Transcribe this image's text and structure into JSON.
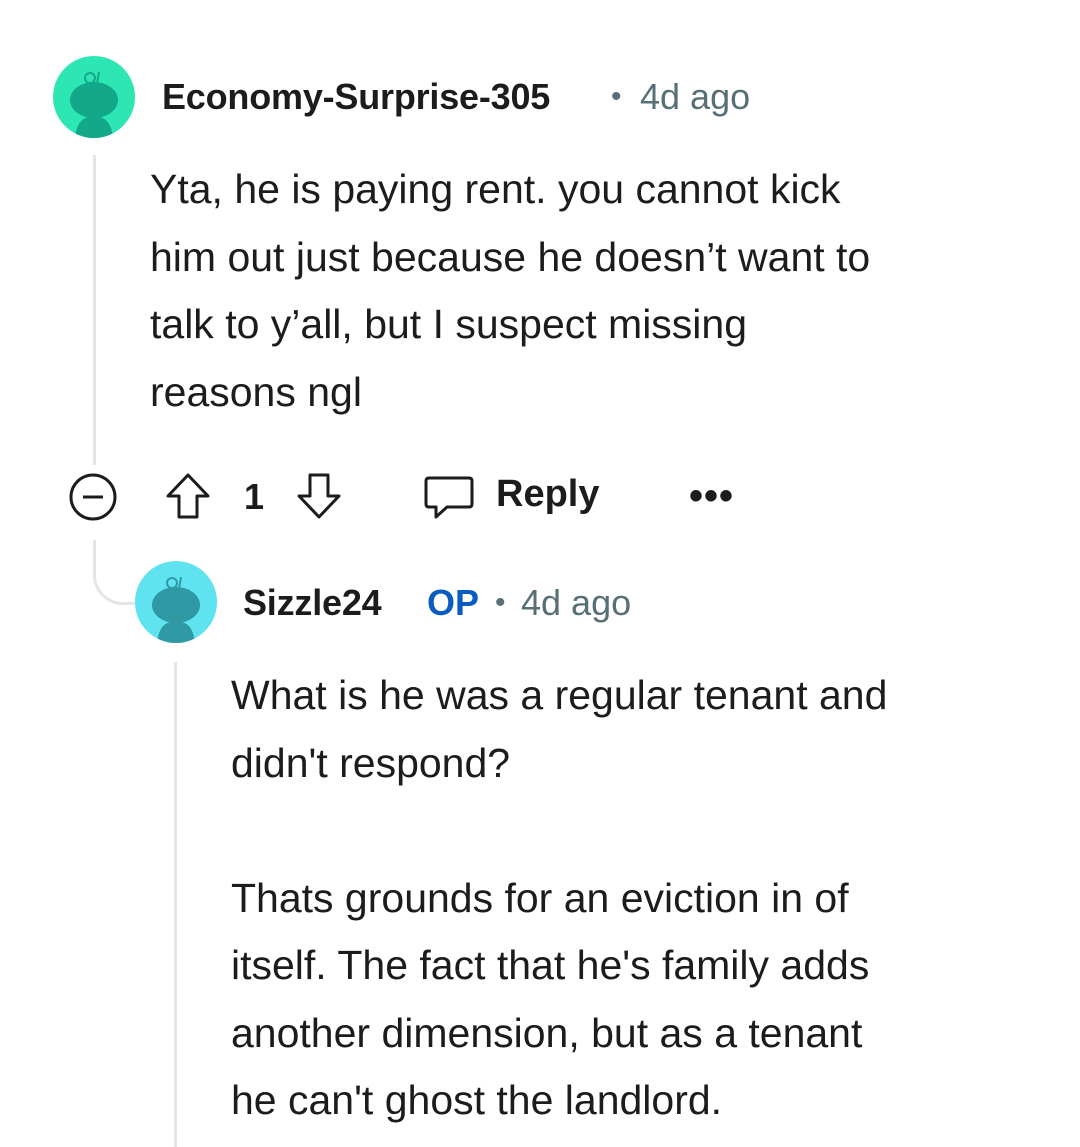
{
  "colors": {
    "avatar1_bg": "#2ee6b4",
    "avatar1_figure": "#14a88a",
    "avatar2_bg": "#5fe3f0",
    "avatar2_figure": "#2f9aa6",
    "op_badge": "#0a5cc2",
    "meta": "#576f76",
    "thread_line": "#e3e6e8"
  },
  "comment": {
    "username": "Economy-Surprise-305",
    "separator": "•",
    "age": "4d ago",
    "text": "Yta, he is paying rent. you cannot kick\nhim out just because he doesn’t want to\ntalk to y’all, but I suspect missing\nreasons ngl",
    "actions": {
      "collapse_icon": "minus-circle-icon",
      "upvote_icon": "arrow-up-icon",
      "score": "1",
      "downvote_icon": "arrow-down-icon",
      "reply_icon": "speech-bubble-icon",
      "reply_label": "Reply",
      "more_label": "•••"
    }
  },
  "reply": {
    "username": "Sizzle24",
    "op_badge": "OP",
    "separator": "•",
    "age": "4d ago",
    "text": "What is he was a regular tenant and\ndidn't respond?\n\nThats grounds for an eviction in of\nitself. The fact that he's family adds\nanother dimension, but as a tenant\nhe can't ghost the landlord."
  }
}
